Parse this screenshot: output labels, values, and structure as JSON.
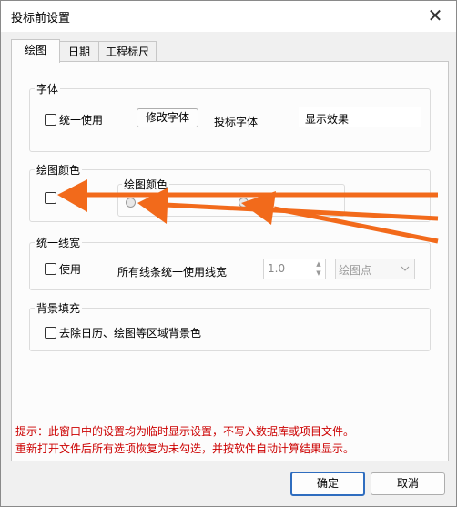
{
  "window": {
    "title": "投标前设置",
    "close_glyph": "✕"
  },
  "tabs": [
    {
      "label": "绘图",
      "active": true
    },
    {
      "label": "日期",
      "active": false
    },
    {
      "label": "工程标尺",
      "active": false
    }
  ],
  "font_group": {
    "title": "字体",
    "unify_label": "统一使用",
    "unify_checked": false,
    "modify_button": "修改字体",
    "font_name_label": "投标字体",
    "preview_text": "显示效果"
  },
  "color_group": {
    "title": "绘图颜色",
    "checked": false,
    "inner_label": "绘图颜色"
  },
  "line_group": {
    "title": "统一线宽",
    "use_label": "使用",
    "checked": false,
    "desc_label": "所有线条统一使用线宽",
    "width_value": "1.0",
    "unit_value": "绘图点"
  },
  "bg_group": {
    "title": "背景填充",
    "remove_label": "去除日历、绘图等区域背景色",
    "checked": false
  },
  "notes": {
    "line1": "提示：此窗口中的设置均为临时显示设置，不写入数据库或项目文件。",
    "line2": "重新打开文件后所有选项恢复为未勾选，并按软件自动计算结果显示。"
  },
  "buttons": {
    "ok": "确定",
    "cancel": "取消"
  },
  "colors": {
    "annotation_arrow": "#f26a1b",
    "note_text": "#cc0000",
    "accent": "#2f6dbf"
  }
}
